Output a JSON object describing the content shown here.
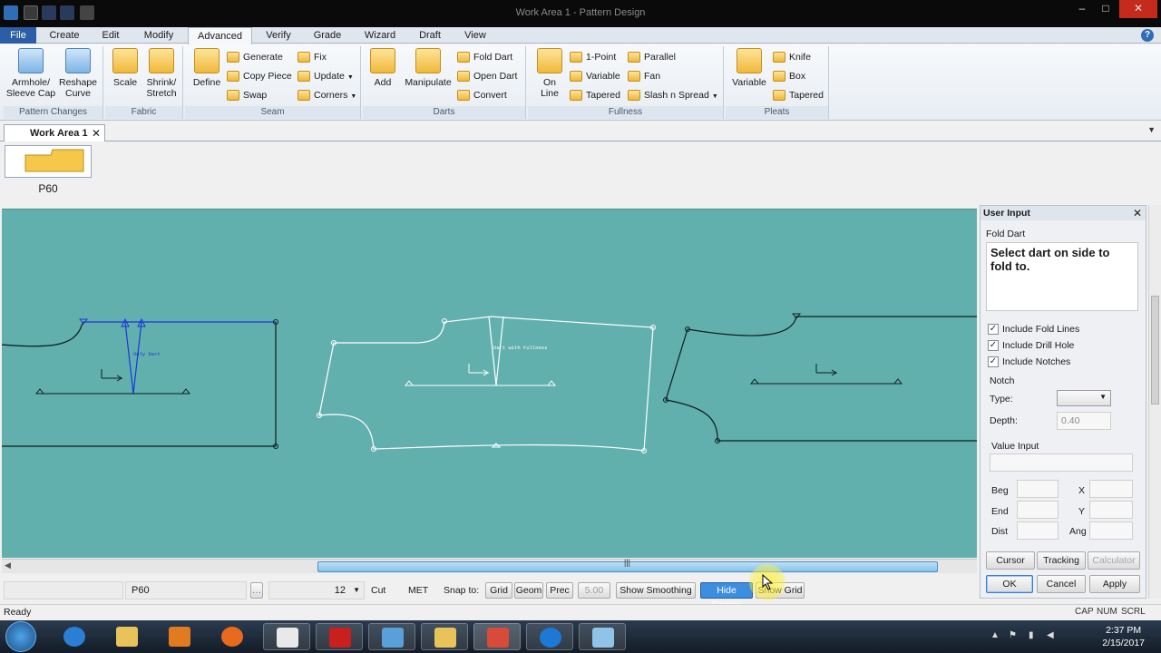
{
  "window": {
    "title": "Work Area 1 - Pattern Design"
  },
  "menu": {
    "tabs": [
      "File",
      "Create",
      "Edit",
      "Modify",
      "Advanced",
      "Verify",
      "Grade",
      "Wizard",
      "Draft",
      "View"
    ],
    "active": "Advanced"
  },
  "ribbon": {
    "groups": {
      "pattern_changes": {
        "label": "Pattern Changes",
        "armhole": "Armhole/\nSleeve Cap",
        "reshape": "Reshape\nCurve"
      },
      "fabric": {
        "label": "Fabric",
        "scale": "Scale",
        "shrink": "Shrink/\nStretch"
      },
      "seam": {
        "label": "Seam",
        "define": "Define",
        "generate": "Generate",
        "copy_piece": "Copy Piece",
        "swap": "Swap",
        "fix": "Fix",
        "update": "Update",
        "corners": "Corners"
      },
      "darts": {
        "label": "Darts",
        "add": "Add",
        "manipulate": "Manipulate",
        "fold_dart": "Fold Dart",
        "open_dart": "Open Dart",
        "convert": "Convert"
      },
      "fullness": {
        "label": "Fullness",
        "on_line": "On\nLine",
        "one_point": "1-Point",
        "variable": "Variable",
        "tapered": "Tapered",
        "parallel": "Parallel",
        "fan": "Fan",
        "slash": "Slash n Spread"
      },
      "pleats": {
        "label": "Pleats",
        "variable": "Variable",
        "knife": "Knife",
        "box": "Box",
        "tapered": "Tapered"
      }
    }
  },
  "workarea": {
    "tab_label": "Work Area 1",
    "piece_label": "P60"
  },
  "canvas": {
    "annotations": {
      "only_dart": "Only Dart",
      "dart_fullness": "Dart with Fullness"
    },
    "colors": {
      "background": "#62b0ae",
      "selected": "#1a35d8",
      "piece_white": "#ffffff",
      "piece_dark": "#0d1c20"
    }
  },
  "bottombar": {
    "piece_field": "P60",
    "size_value": "12",
    "cut": "Cut",
    "units": "MET",
    "snap_label": "Snap to:",
    "grid": "Grid",
    "geom": "Geom",
    "prec": "Prec",
    "prec_value": "5.00",
    "show_smoothing": "Show Smoothing",
    "hide_seams": "Hide Seams",
    "show_grid": "Show Grid"
  },
  "status": {
    "text": "Ready",
    "caps": "CAP",
    "num": "NUM",
    "scrl": "SCRL"
  },
  "taskbar": {
    "time": "2:37 PM",
    "date": "2/15/2017"
  },
  "user_input": {
    "title": "User Input",
    "function": "Fold Dart",
    "prompt": "Select dart on side to fold to.",
    "include_fold_lines": "Include Fold Lines",
    "include_drill_hole": "Include Drill Hole",
    "include_notches": "Include Notches",
    "notch_label": "Notch",
    "type_label": "Type:",
    "depth_label": "Depth:",
    "depth_value": "0.40",
    "value_input_label": "Value Input",
    "beg": "Beg",
    "end": "End",
    "dist": "Dist",
    "x": "X",
    "y": "Y",
    "ang": "Ang",
    "cursor": "Cursor",
    "tracking": "Tracking",
    "calculator": "Calculator",
    "ok": "OK",
    "cancel": "Cancel",
    "apply": "Apply"
  }
}
